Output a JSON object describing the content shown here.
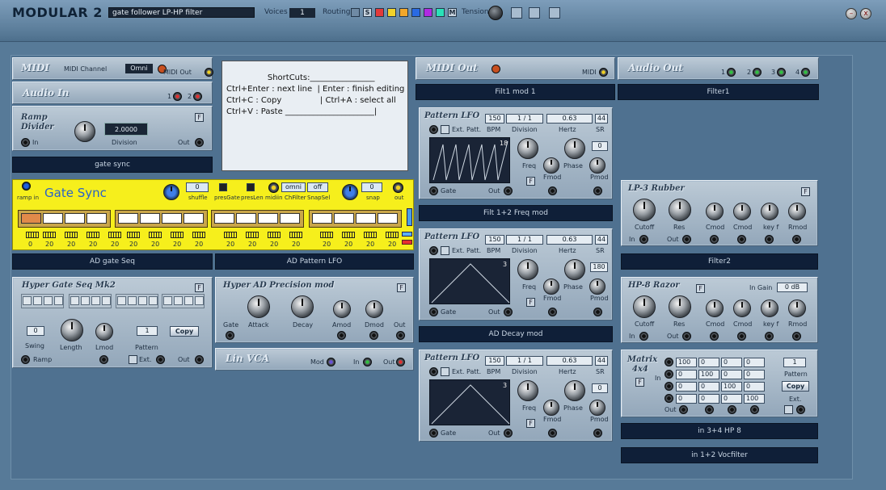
{
  "app": {
    "title": "MODULAR 2",
    "patch_name": "gate follower LP-HP filter",
    "voices_label": "Voices",
    "voices_value": "1",
    "routing_label": "Routing",
    "routing_s": "S",
    "routing_m": "M",
    "tension_label": "Tension"
  },
  "routing_colors": [
    "#e23a3a",
    "#f2d22a",
    "#f2a72a",
    "#2a6ae2",
    "#b02ae2",
    "#2ae2b8",
    "#2ac24a"
  ],
  "memo": {
    "text": "                ShortCuts:________________\nCtrl+Enter : next line  | Enter : finish editing\nCtrl+C : Copy               | Ctrl+A : select all\nCtrl+V : Paste ______________________|"
  },
  "midi": {
    "title": "MIDI",
    "channel_label": "MIDI Channel",
    "channel_value": "Omni",
    "out_label": "MIDI Out"
  },
  "audio_in": {
    "title": "Audio In",
    "p1": "1",
    "p2": "2"
  },
  "ramp_divider": {
    "title1": "Ramp",
    "title2": "Divider",
    "value": "2.0000",
    "division": "Division",
    "in": "In",
    "out": "Out",
    "strip": "gate sync"
  },
  "midi_out": {
    "title": "MIDI Out",
    "midi": "MIDI",
    "strip": "Filt1  mod 1"
  },
  "audio_out": {
    "title": "Audio Out",
    "p1": "1",
    "p2": "2",
    "p3": "3",
    "p4": "4",
    "strip": "Filter1"
  },
  "gate_sync": {
    "title": "Gate Sync",
    "ramp_in": "ramp in",
    "shuffle_val": "0",
    "shuffle": "shuffle",
    "presgate": "presGate",
    "preslen": "presLen",
    "midiin": "midiin",
    "chfilter_val": "omni",
    "chfilter": "ChFilter",
    "snapsel_val": "off",
    "snapsel": "SnapSel",
    "snap_val": "0",
    "snap": "snap",
    "out": "out",
    "lengths": [
      "0",
      "20",
      "20",
      "20",
      "20",
      "20",
      "20",
      "20",
      "20",
      "20",
      "20",
      "20",
      "20",
      "20",
      "20",
      "20",
      "20"
    ],
    "strip_left": "AD gate Seq",
    "strip_right": "AD Pattern LFO"
  },
  "lfo1": {
    "title": "Pattern LFO",
    "bpm_val": "150",
    "div_val": "1 / 1",
    "hz_val": "0.63",
    "sr_val": "44",
    "ext": "Ext. Patt.",
    "bpm": "BPM",
    "division": "Division",
    "hertz": "Hertz",
    "sr": "SR",
    "step": "18",
    "phase_val": "0",
    "freq": "Freq",
    "phase": "Phase",
    "fmod": "Fmod",
    "pmod": "Pmod",
    "gate": "Gate",
    "out": "Out",
    "strip": "Filt 1+2 Freq mod"
  },
  "lfo2": {
    "title": "Pattern LFO",
    "bpm_val": "150",
    "div_val": "1 / 1",
    "hz_val": "0.63",
    "sr_val": "44",
    "ext": "Ext. Patt.",
    "bpm": "BPM",
    "division": "Division",
    "hertz": "Hertz",
    "sr": "SR",
    "step": "3",
    "phase_val": "180",
    "freq": "Freq",
    "phase": "Phase",
    "fmod": "Fmod",
    "pmod": "Pmod",
    "gate": "Gate",
    "out": "Out",
    "strip": "AD Decay mod"
  },
  "lfo3": {
    "title": "Pattern LFO",
    "bpm_val": "150",
    "div_val": "1 / 1",
    "hz_val": "0.63",
    "sr_val": "44",
    "ext": "Ext. Patt.",
    "bpm": "BPM",
    "division": "Division",
    "hertz": "Hertz",
    "sr": "SR",
    "step": "3",
    "phase_val": "0",
    "freq": "Freq",
    "phase": "Phase",
    "fmod": "Fmod",
    "pmod": "Pmod",
    "gate": "Gate",
    "out": "Out"
  },
  "lp3": {
    "title": "LP-3 Rubber",
    "cutoff": "Cutoff",
    "res": "Res",
    "cmod1": "Cmod",
    "cmod2": "Cmod",
    "keyf": "key f",
    "rmod": "Rmod",
    "in": "In",
    "out": "Out",
    "strip": "Filter2"
  },
  "hp8": {
    "title": "HP-8 Razor",
    "ingain_label": "In Gain",
    "ingain_val": "0 dB",
    "cutoff": "Cutoff",
    "res": "Res",
    "cmod1": "Cmod",
    "cmod2": "Cmod",
    "keyf": "key f",
    "rmod": "Rmod",
    "in": "In",
    "out": "Out"
  },
  "matrix": {
    "title1": "Matrix",
    "title2": "4x4",
    "in": "In",
    "out": "Out",
    "pattern_val": "1",
    "pattern": "Pattern",
    "copy": "Copy",
    "ext": "Ext.",
    "rows": [
      [
        "100",
        "0",
        "0",
        "0"
      ],
      [
        "0",
        "100",
        "0",
        "0"
      ],
      [
        "0",
        "0",
        "100",
        "0"
      ],
      [
        "0",
        "0",
        "0",
        "100"
      ]
    ],
    "strip1": "in 3+4 HP 8",
    "strip2": "in 1+2 Vocfilter"
  },
  "hyper_gate": {
    "title": "Hyper Gate Seq Mk2",
    "swing_val": "0",
    "swing": "Swing",
    "length": "Length",
    "lmod": "Lmod",
    "pattern_val": "1",
    "pattern": "Pattern",
    "copy": "Copy",
    "ramp": "Ramp",
    "ext": "Ext.",
    "out": "Out"
  },
  "hyper_ad": {
    "title": "Hyper AD Precision mod",
    "gate": "Gate",
    "attack": "Attack",
    "decay": "Decay",
    "amod": "Amod",
    "dmod": "Dmod",
    "out": "Out"
  },
  "lin_vca": {
    "title": "Lin VCA",
    "mod": "Mod",
    "in": "In",
    "out": "Out"
  }
}
